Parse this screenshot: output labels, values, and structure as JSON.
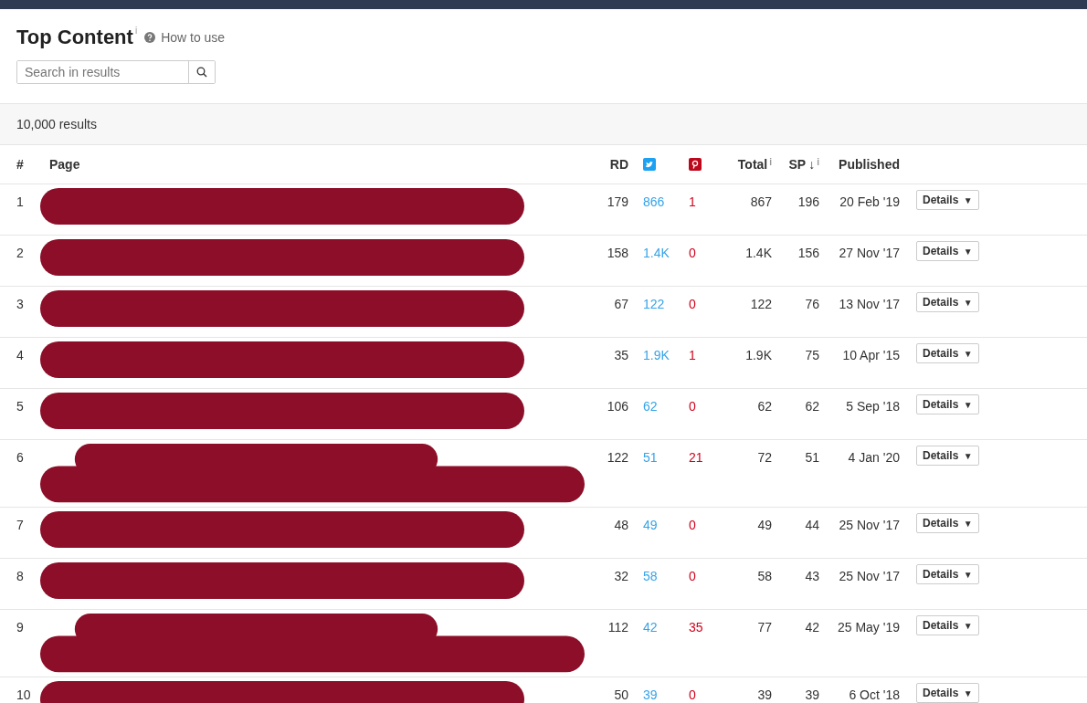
{
  "header": {
    "title": "Top Content",
    "title_info": "i",
    "help_link": "How to use",
    "search": {
      "placeholder": "Search in results"
    }
  },
  "results_count": "10,000 results",
  "table": {
    "columns": [
      {
        "label": "#",
        "kind": "text"
      },
      {
        "label": "Page",
        "kind": "text"
      },
      {
        "label": "RD",
        "kind": "text"
      },
      {
        "kind": "twitter"
      },
      {
        "kind": "pinterest"
      },
      {
        "label": "Total",
        "kind": "info",
        "info": "i"
      },
      {
        "label": "SP",
        "kind": "sorted",
        "sort": "↓",
        "info": "i"
      },
      {
        "label": "Published",
        "kind": "text"
      }
    ],
    "rows": [
      {
        "num": "1",
        "kind": "single",
        "rd": "179",
        "twitter": "866",
        "pinterest": "1",
        "total": "867",
        "sp": "196",
        "published": "20 Feb '19",
        "action": "Details",
        "caret": "▼"
      },
      {
        "num": "2",
        "kind": "single",
        "rd": "158",
        "twitter": "1.4K",
        "pinterest": "0",
        "total": "1.4K",
        "sp": "156",
        "published": "27 Nov '17",
        "action": "Details",
        "caret": "▼"
      },
      {
        "num": "3",
        "kind": "single",
        "rd": "67",
        "twitter": "122",
        "pinterest": "0",
        "total": "122",
        "sp": "76",
        "published": "13 Nov '17",
        "action": "Details",
        "caret": "▼"
      },
      {
        "num": "4",
        "kind": "single",
        "rd": "35",
        "twitter": "1.9K",
        "pinterest": "1",
        "total": "1.9K",
        "sp": "75",
        "published": "10 Apr '15",
        "action": "Details",
        "caret": "▼"
      },
      {
        "num": "5",
        "kind": "single",
        "rd": "106",
        "twitter": "62",
        "pinterest": "0",
        "total": "62",
        "sp": "62",
        "published": "5 Sep '18",
        "action": "Details",
        "caret": "▼"
      },
      {
        "num": "6",
        "kind": "double",
        "rd": "122",
        "twitter": "51",
        "pinterest": "21",
        "total": "72",
        "sp": "51",
        "published": "4 Jan '20",
        "action": "Details",
        "caret": "▼"
      },
      {
        "num": "7",
        "kind": "single",
        "rd": "48",
        "twitter": "49",
        "pinterest": "0",
        "total": "49",
        "sp": "44",
        "published": "25 Nov '17",
        "action": "Details",
        "caret": "▼"
      },
      {
        "num": "8",
        "kind": "single",
        "rd": "32",
        "twitter": "58",
        "pinterest": "0",
        "total": "58",
        "sp": "43",
        "published": "25 Nov '17",
        "action": "Details",
        "caret": "▼"
      },
      {
        "num": "9",
        "kind": "double",
        "rd": "112",
        "twitter": "42",
        "pinterest": "35",
        "total": "77",
        "sp": "42",
        "published": "25 May '19",
        "action": "Details",
        "caret": "▼"
      },
      {
        "num": "10",
        "kind": "single",
        "rd": "50",
        "twitter": "39",
        "pinterest": "0",
        "total": "39",
        "sp": "39",
        "published": "6 Oct '18",
        "action": "Details",
        "caret": "▼"
      }
    ]
  }
}
